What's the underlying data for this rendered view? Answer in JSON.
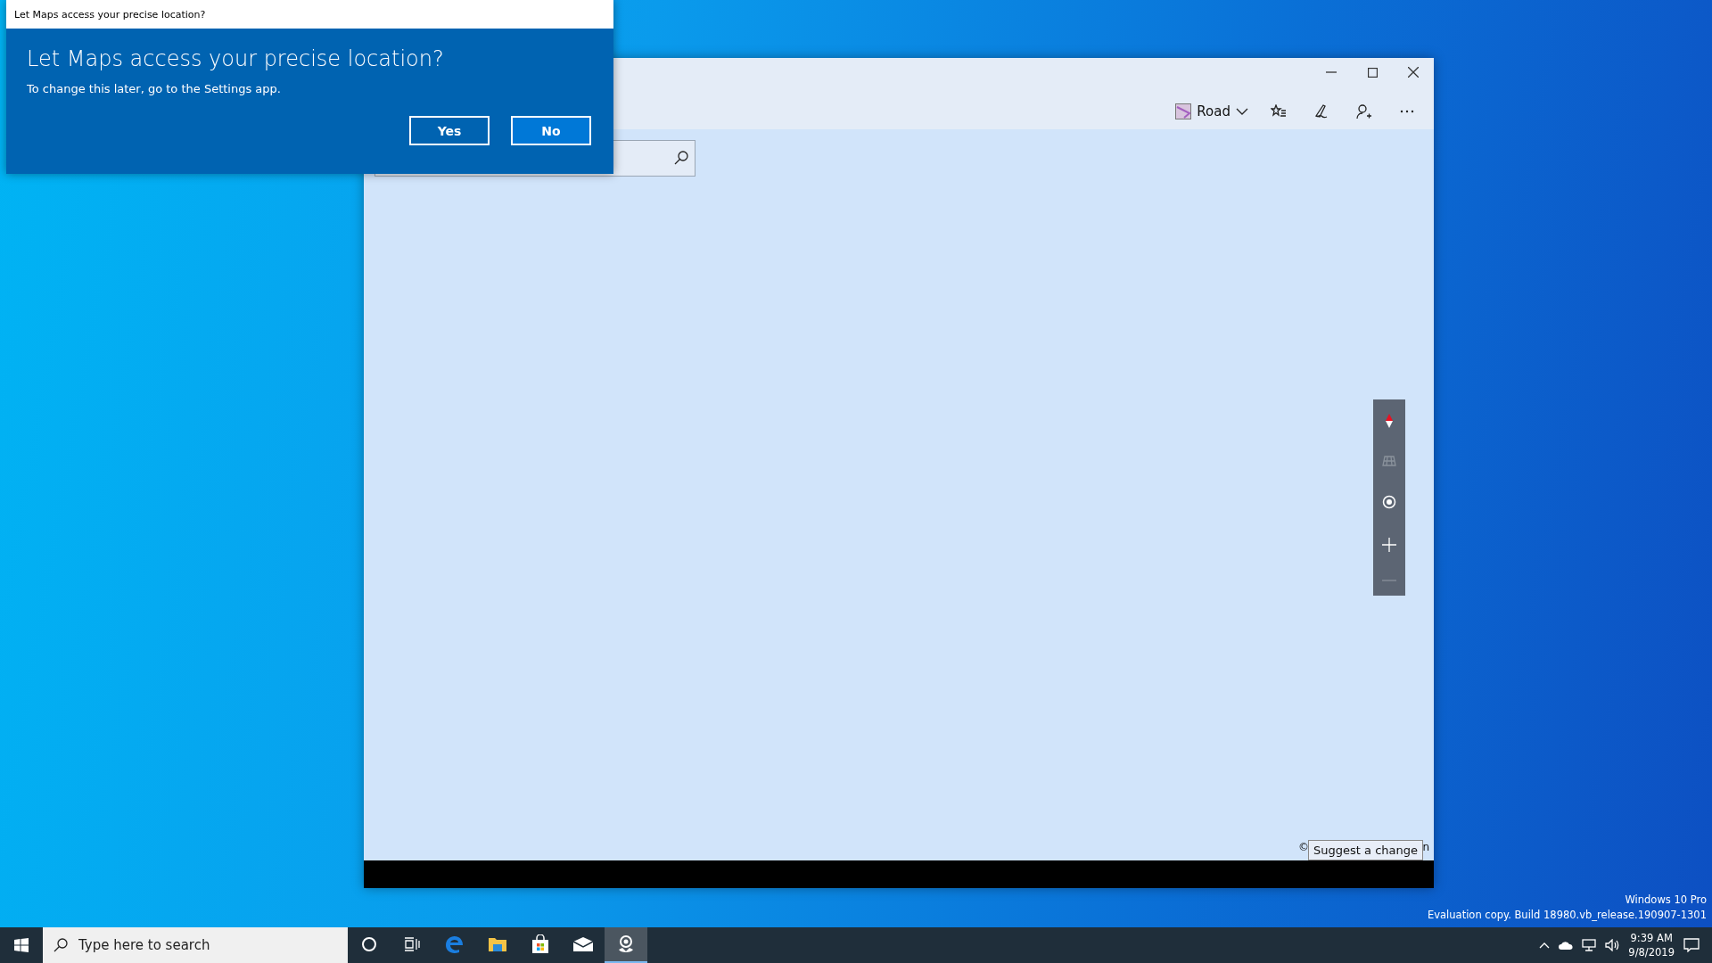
{
  "dialog": {
    "title": "Let Maps access your precise location?",
    "heading": "Let Maps access your precise location?",
    "message": "To change this later, go to the Settings app.",
    "buttons": [
      {
        "label": "Yes",
        "selected": false
      },
      {
        "label": "No",
        "selected": true
      }
    ]
  },
  "maps_window": {
    "map_style": "Road",
    "copyright_start": "©",
    "copyright_end": "n",
    "tooltip": "Suggest a change"
  },
  "desktop": {
    "edition": "Windows 10 Pro",
    "build": "Evaluation copy. Build 18980.vb_release.190907-1301"
  },
  "taskbar": {
    "search": {
      "placeholder": "Type here to search"
    },
    "apps": [
      {
        "kind": "cortana",
        "selected": false
      },
      {
        "kind": "taskview",
        "selected": false
      },
      {
        "kind": "edge",
        "selected": false
      },
      {
        "kind": "explorer",
        "selected": false
      },
      {
        "kind": "store",
        "selected": false
      },
      {
        "kind": "mail",
        "selected": false
      },
      {
        "kind": "maps",
        "selected": true
      }
    ],
    "time": "9:39 AM",
    "date": "9/8/2019"
  }
}
